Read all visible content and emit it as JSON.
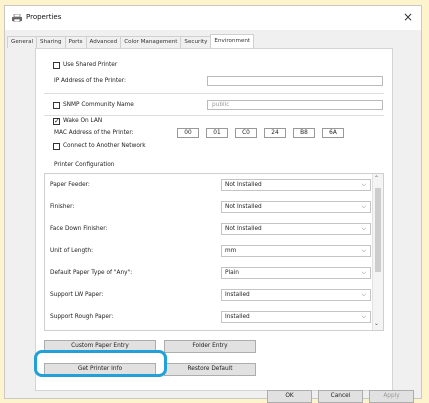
{
  "window": {
    "title": "Properties",
    "close_glyph": "×"
  },
  "tabs": [
    "General",
    "Sharing",
    "Ports",
    "Advanced",
    "Color Management",
    "Security",
    "Environment"
  ],
  "active_tab": "Environment",
  "environment": {
    "use_shared_printer": {
      "label": "Use Shared Printer",
      "checked": false
    },
    "ip_address": {
      "label": "IP Address of the Printer:",
      "value": ""
    },
    "snmp": {
      "label": "SNMP Community Name",
      "value": "public",
      "checked": false
    },
    "wake_on_lan": {
      "label": "Wake On LAN",
      "checked": true
    },
    "mac": {
      "label": "MAC Address of the Printer:",
      "octets": [
        "00",
        "01",
        "C0",
        "24",
        "B8",
        "6A"
      ]
    },
    "connect_network": {
      "label": "Connect to Another Network",
      "checked": false
    },
    "printer_configuration": {
      "title": "Printer Configuration",
      "rows": [
        {
          "label": "Paper Feeder:",
          "value": "Not Installed"
        },
        {
          "label": "Finisher:",
          "value": "Not Installed"
        },
        {
          "label": "Face Down Finisher:",
          "value": "Not Installed"
        },
        {
          "label": "Unit of Length:",
          "value": "mm"
        },
        {
          "label": "Default Paper Type of \"Any\":",
          "value": "Plain"
        },
        {
          "label": "Support LW Paper:",
          "value": "Installed"
        },
        {
          "label": "Support Rough Paper:",
          "value": "Installed"
        }
      ]
    },
    "buttons": {
      "custom_paper_entry": "Custom Paper Entry",
      "folder_entry": "Folder Entry",
      "get_printer_info": "Get Printer Info",
      "restore_default": "Restore Default"
    }
  },
  "footer": {
    "ok": "OK",
    "cancel": "Cancel",
    "apply": "Apply"
  },
  "colors": {
    "highlight": "#23a0d6",
    "background": "#fdf3cc"
  }
}
